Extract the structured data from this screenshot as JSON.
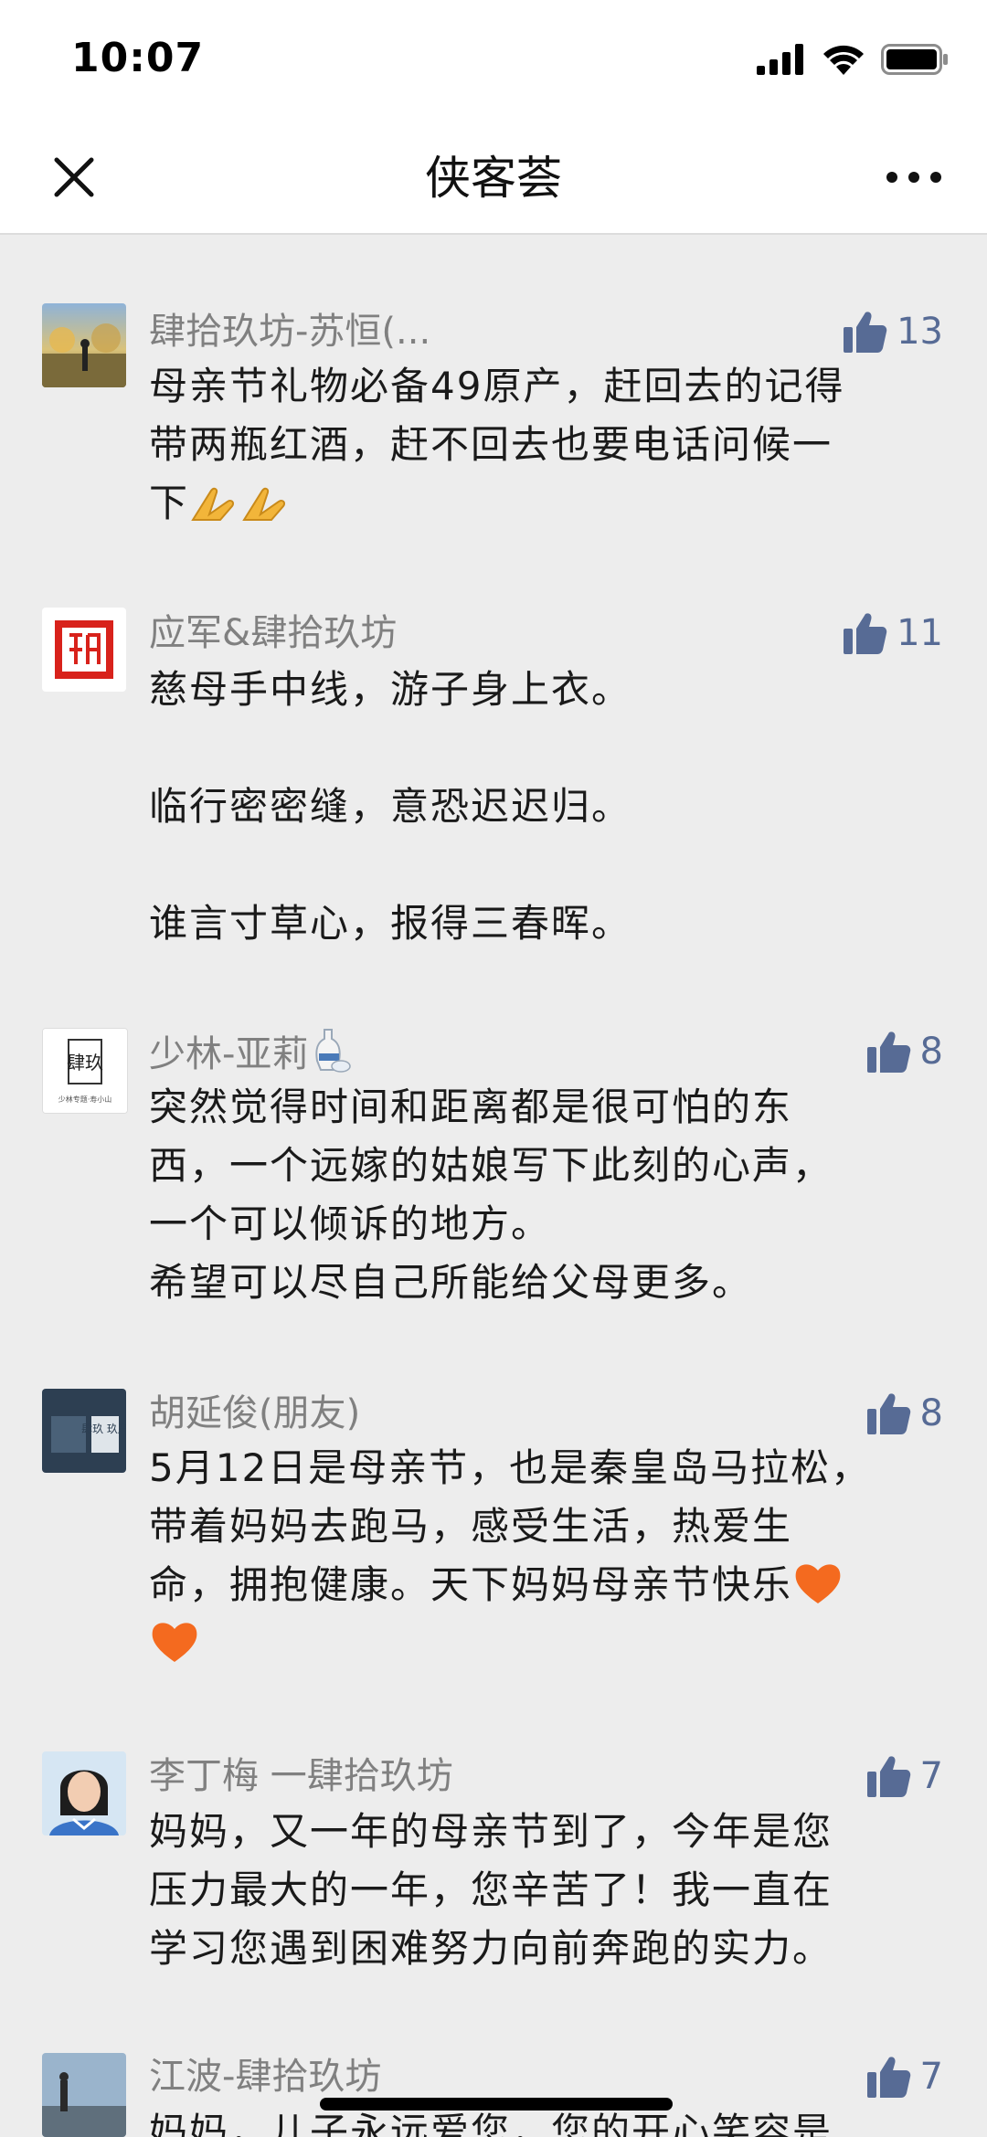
{
  "status_bar": {
    "time": "10:07"
  },
  "nav": {
    "title": "侠客荟"
  },
  "comments": [
    {
      "name": "肆拾玖坊-苏恒(...",
      "likes": "13",
      "lines": [
        "母亲节礼物必备49原产，赶回去的记得",
        "带两瓶红酒，赶不回去也要电话问候一",
        "下"
      ]
    },
    {
      "name": "应军&肆拾玖坊",
      "likes": "11",
      "lines": [
        "慈母手中线，游子身上衣。",
        "临行密密缝，意恐迟迟归。",
        "谁言寸草心，报得三春晖。"
      ]
    },
    {
      "name": "少林-亚莉",
      "likes": "8",
      "lines": [
        "突然觉得时间和距离都是很可怕的东",
        "西，一个远嫁的姑娘写下此刻的心声，",
        "一个可以倾诉的地方。",
        "希望可以尽自己所能给父母更多。"
      ]
    },
    {
      "name": "胡延俊(朋友)",
      "likes": "8",
      "lines": [
        "5月12日是母亲节，也是秦皇岛马拉松，",
        "带着妈妈去跑马，感受生活，热爱生",
        "命，拥抱健康。天下妈妈母亲节快乐"
      ]
    },
    {
      "name": "李丁梅 一肆拾玖坊",
      "likes": "7",
      "lines": [
        "妈妈，又一年的母亲节到了，今年是您",
        "压力最大的一年，您辛苦了！我一直在",
        "学习您遇到困难努力向前奔跑的实力。"
      ]
    },
    {
      "name": "江波-肆拾玖坊",
      "likes": "7",
      "lines": [
        "妈妈，儿子永远爱您，您的开心笑容是"
      ]
    }
  ],
  "avatar_texts": {
    "c3_seal": "肆玖",
    "c3_caption": "少林专题·寿小山",
    "c4_text": "肆玖 玖产"
  },
  "colors": {
    "link_blue": "#576b95",
    "name_gray": "#808080",
    "background": "#ededed"
  }
}
